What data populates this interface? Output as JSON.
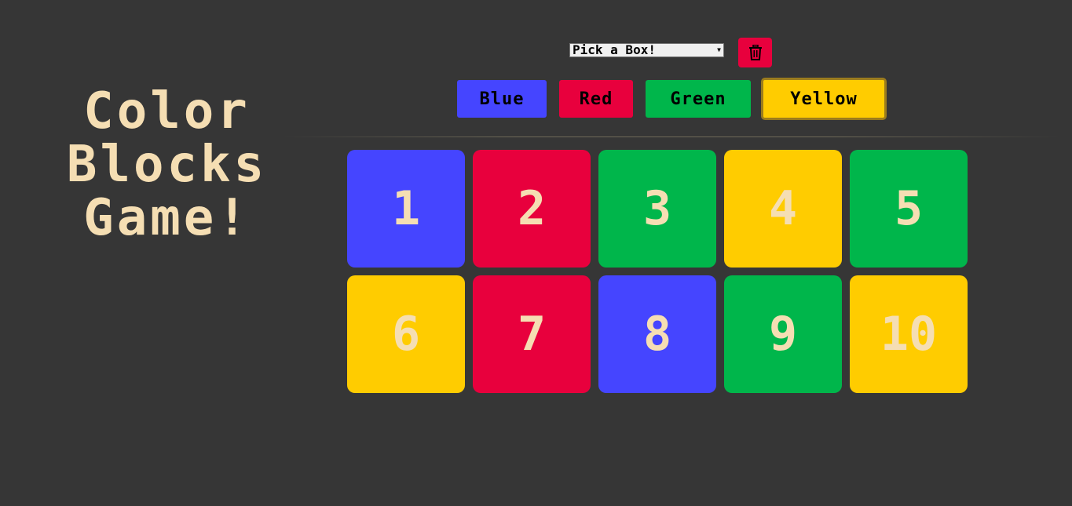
{
  "title": {
    "line1": "Color",
    "line2": "Blocks",
    "line3": "Game!"
  },
  "controls": {
    "select_value": "Pick a Box!",
    "delete_icon": "trash-icon"
  },
  "color_buttons": {
    "blue": "Blue",
    "red": "Red",
    "green": "Green",
    "yellow": "Yellow",
    "selected": "Yellow"
  },
  "colors": {
    "background": "#363636",
    "blue": "#4545ff",
    "red": "#e8003d",
    "green": "#00b64b",
    "yellow": "#ffcc00",
    "text": "#f5deb3"
  },
  "boxes": [
    {
      "label": "1",
      "color": "#4545ff"
    },
    {
      "label": "2",
      "color": "#e8003d"
    },
    {
      "label": "3",
      "color": "#00b64b"
    },
    {
      "label": "4",
      "color": "#ffcc00"
    },
    {
      "label": "5",
      "color": "#00b64b"
    },
    {
      "label": "6",
      "color": "#ffcc00"
    },
    {
      "label": "7",
      "color": "#e8003d"
    },
    {
      "label": "8",
      "color": "#4545ff"
    },
    {
      "label": "9",
      "color": "#00b64b"
    },
    {
      "label": "10",
      "color": "#ffcc00"
    }
  ]
}
